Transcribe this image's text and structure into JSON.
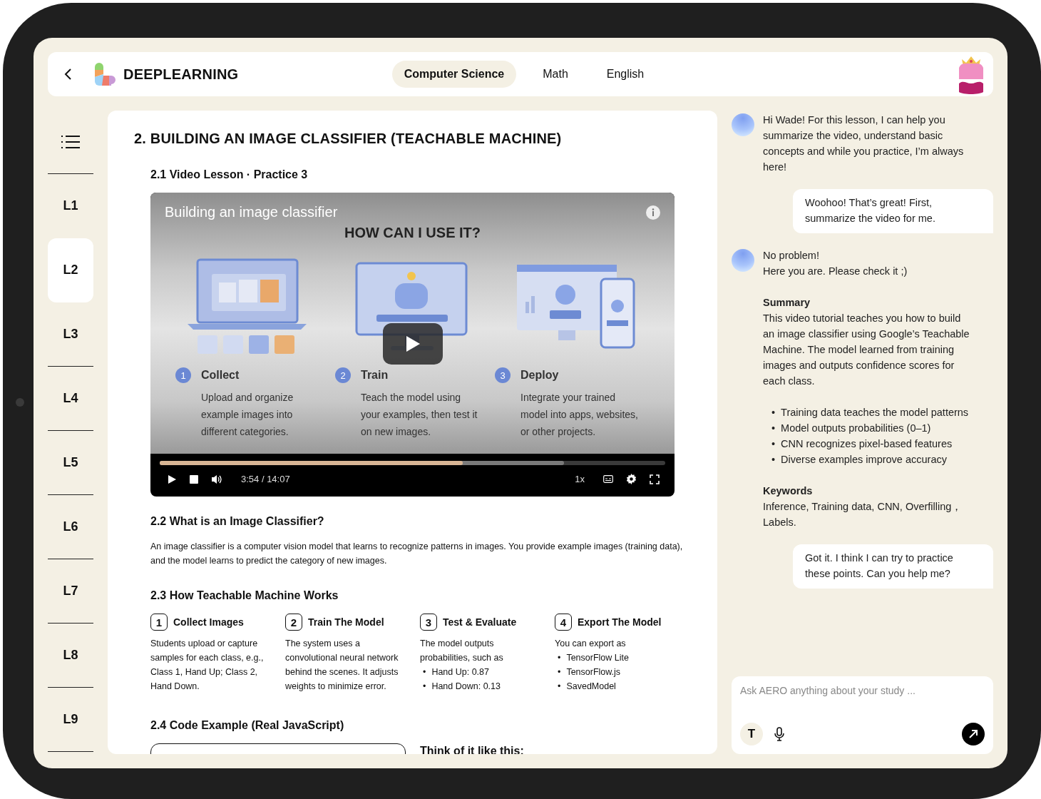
{
  "header": {
    "logo": "DEEPLEARNING",
    "tabs": [
      {
        "label": "Computer Science",
        "selected": true
      },
      {
        "label": "Math",
        "selected": false
      },
      {
        "label": "English",
        "selected": false
      }
    ]
  },
  "sidebar": {
    "lessons": [
      {
        "label": "L1",
        "selected": false
      },
      {
        "label": "L2",
        "selected": true
      },
      {
        "label": "L3",
        "selected": false
      },
      {
        "label": "L4",
        "selected": false
      },
      {
        "label": "L5",
        "selected": false
      },
      {
        "label": "L6",
        "selected": false
      },
      {
        "label": "L7",
        "selected": false
      },
      {
        "label": "L8",
        "selected": false
      },
      {
        "label": "L9",
        "selected": false
      }
    ]
  },
  "lesson": {
    "title": "2. BUILDING AN IMAGE CLASSIFIER (TEACHABLE MACHINE)",
    "video_section": {
      "heading": "2.1 Video Lesson · Practice 3",
      "video": {
        "title": "Building an image classifier",
        "slide_heading": "HOW CAN I USE IT?",
        "steps": [
          {
            "number": "1",
            "title": "Collect",
            "text": "Upload and organize example images into different categories."
          },
          {
            "number": "2",
            "title": "Train",
            "text": "Teach the model using your examples, then test it on new images."
          },
          {
            "number": "3",
            "title": "Deploy",
            "text": "Integrate your trained model into apps, websites, or other projects."
          }
        ],
        "progress": {
          "level": 0.6
        },
        "buffer": {
          "level": 0.8
        },
        "time": "3:54 / 14:07",
        "speed": "1x"
      }
    },
    "sections": [
      {
        "kind": "paragraph",
        "heading": "2.2 What is an Image Classifier?",
        "text": "An image classifier is a computer vision model that learns to recognize patterns in images. You provide example images (training data), and the model learns to predict the category of new images."
      },
      {
        "kind": "steps",
        "heading": "2.3 How Teachable Machine Works",
        "steps": [
          {
            "number": "1",
            "title": "Collect Images",
            "text": "Students upload or capture samples for each class, e.g., Class 1, Hand Up; Class 2, Hand Down."
          },
          {
            "number": "2",
            "title": "Train The Model",
            "text": "The system uses a convolutional neural network behind the scenes. It adjusts weights to minimize error."
          },
          {
            "number": "3",
            "title": "Test & Evaluate",
            "text": "The model outputs probabilities, such as",
            "bullet_marker": "•",
            "bullets": [
              "Hand Up: 0.87",
              "Hand Down: 0.13"
            ]
          },
          {
            "number": "4",
            "title": "Export The Model",
            "text": "You can export as",
            "bullet_marker": "•",
            "bullets": [
              "TensorFlow Lite",
              "TensorFlow.js",
              "SavedModel"
            ]
          }
        ]
      },
      {
        "kind": "code",
        "heading": "2.4 Code Example (Real JavaScript)",
        "aside_heading": "Think of it like this:"
      }
    ]
  },
  "chat": {
    "messages": [
      {
        "kind": "bot",
        "lines": [
          "Hi Wade! For this lesson, I can help you summarize the video, understand basic concepts and while you practice, I’m always here!"
        ]
      },
      {
        "kind": "user",
        "text": "Woohoo! That’s great! First, summarize the video for me."
      },
      {
        "kind": "bot",
        "lines": [
          "No problem!",
          "Here you are. Please check it ;)"
        ],
        "sections": [
          {
            "heading": "Summary",
            "text": "This video tutorial teaches you how to build an image classifier using Google’s Teachable Machine. The model learned from training images and outputs confidence scores for each class.",
            "bullet_marker": "•",
            "bullets": [
              "Training data teaches the model patterns",
              "Model outputs probabilities (0–1)",
              "CNN recognizes pixel-based features",
              "Diverse examples improve accuracy"
            ]
          },
          {
            "heading": "Keywords",
            "text": "Inference, Training data, CNN, Overfilling，Labels."
          }
        ]
      },
      {
        "kind": "user",
        "text": "Got it. I think I can try to practice these points. Can you help me?"
      }
    ],
    "input": {
      "placeholder": "Ask AERO anything about your study ...",
      "format_button": "T"
    }
  }
}
